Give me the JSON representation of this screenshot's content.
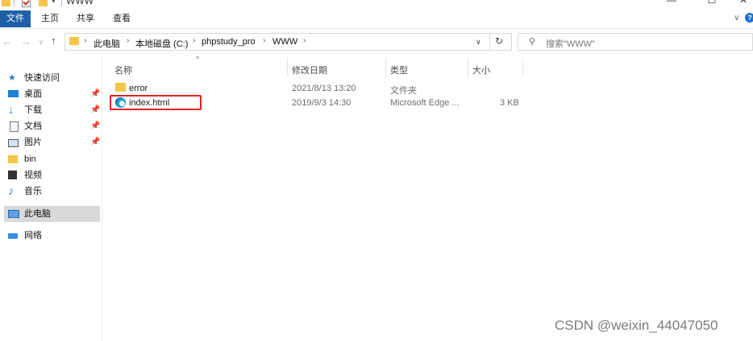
{
  "window": {
    "title": "WWW",
    "minimize": "—",
    "maximize": "☐",
    "close": "✕"
  },
  "ribbon": {
    "tabs": [
      "文件",
      "主页",
      "共享",
      "查看"
    ]
  },
  "nav": {
    "back": "←",
    "forward": "→",
    "up": "↑",
    "dropdown": "∨",
    "refresh": "↻"
  },
  "breadcrumb": [
    "此电脑",
    "本地磁盘 (C:)",
    "phpstudy_pro",
    "WWW"
  ],
  "search": {
    "placeholder": "搜索\"WWW\""
  },
  "sidebar": {
    "quick_access": "快速访问",
    "items": [
      {
        "label": "桌面",
        "icon": "desktop-icon",
        "pinned": true
      },
      {
        "label": "下载",
        "icon": "download-icon",
        "pinned": true
      },
      {
        "label": "文档",
        "icon": "document-icon",
        "pinned": true
      },
      {
        "label": "图片",
        "icon": "pictures-icon",
        "pinned": true
      },
      {
        "label": "bin",
        "icon": "folder-icon",
        "pinned": false
      },
      {
        "label": "视频",
        "icon": "video-icon",
        "pinned": false
      },
      {
        "label": "音乐",
        "icon": "music-icon",
        "pinned": false
      }
    ],
    "this_pc": "此电脑",
    "network": "网络"
  },
  "columns": {
    "name": "名称",
    "date": "修改日期",
    "type": "类型",
    "size": "大小"
  },
  "files": [
    {
      "name": "error",
      "date": "2021/8/13 13:20",
      "type": "文件夹",
      "size": "",
      "icon": "folder-icon"
    },
    {
      "name": "index.html",
      "date": "2019/9/3 14:30",
      "type": "Microsoft Edge ...",
      "size": "3 KB",
      "icon": "edge-icon"
    }
  ],
  "watermark": "CSDN @weixin_44047050",
  "colors": {
    "accent": "#1f5fa8",
    "folder": "#f6c44a",
    "highlight": "#e32222"
  }
}
